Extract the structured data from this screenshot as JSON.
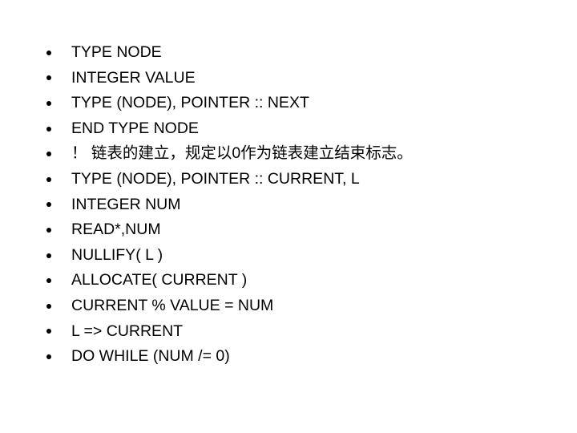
{
  "slide": {
    "lines": [
      "TYPE  NODE",
      "INTEGER  VALUE",
      "TYPE (NODE), POINTER :: NEXT",
      "END  TYPE  NODE",
      "！ 链表的建立，规定以0作为链表建立结束标志。",
      "TYPE (NODE), POINTER :: CURRENT, L",
      "INTEGER  NUM",
      "READ*,NUM",
      "NULLIFY( L )",
      "ALLOCATE( CURRENT )",
      "CURRENT % VALUE = NUM",
      "L => CURRENT",
      "DO WHILE (NUM /= 0)"
    ]
  }
}
